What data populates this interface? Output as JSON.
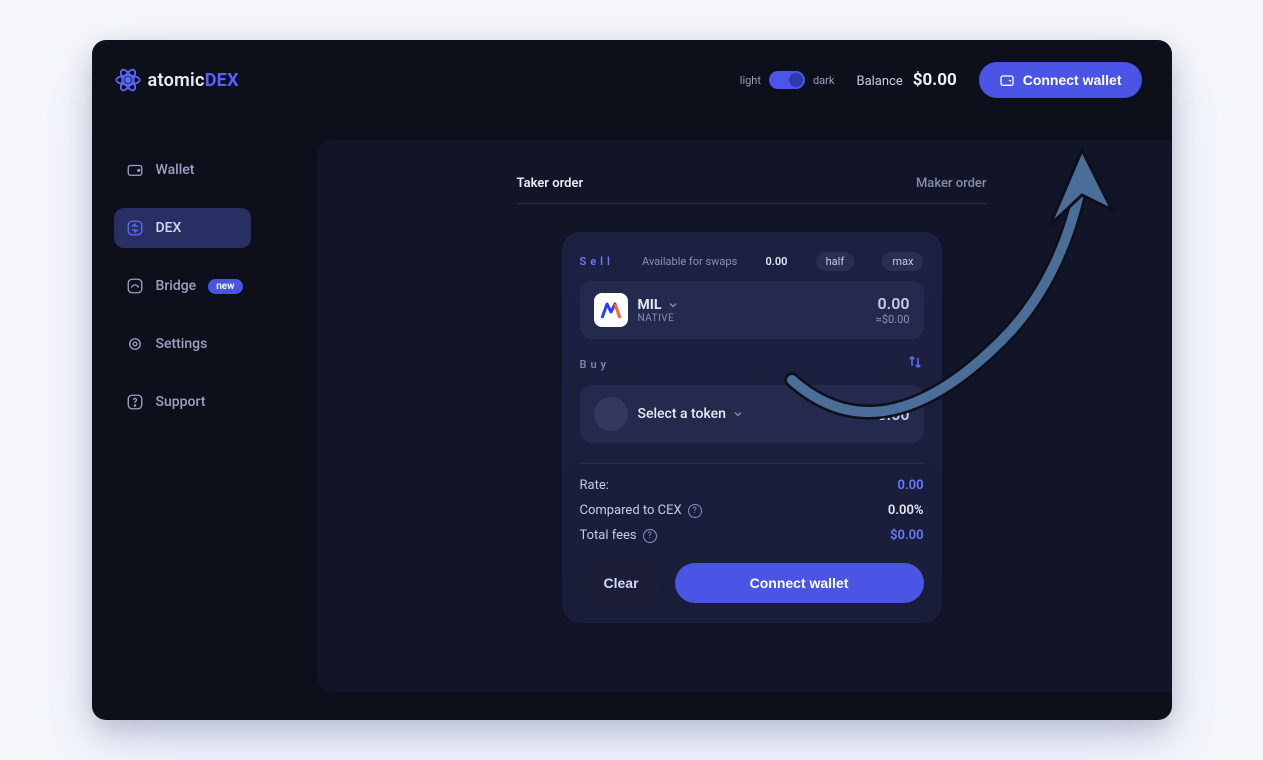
{
  "brand": {
    "part1": "atomic",
    "part2": "DEX"
  },
  "header": {
    "theme_light": "light",
    "theme_dark": "dark",
    "balance_label": "Balance",
    "balance_value": "$0.00",
    "connect_label": "Connect wallet"
  },
  "sidebar": {
    "items": [
      {
        "label": "Wallet"
      },
      {
        "label": "DEX"
      },
      {
        "label": "Bridge",
        "badge": "new"
      },
      {
        "label": "Settings"
      },
      {
        "label": "Support"
      }
    ]
  },
  "tabs": {
    "taker": "Taker order",
    "maker": "Maker order"
  },
  "swap": {
    "sell_label": "Sell",
    "available_label": "Available for swaps",
    "available_value": "0.00",
    "half": "half",
    "max": "max",
    "sell_token_symbol": "MIL",
    "sell_token_sub": "NATIVE",
    "sell_amount": "0.00",
    "sell_amount_fiat": "≈$0.00",
    "buy_label": "Buy",
    "buy_select_label": "Select a token",
    "buy_amount": "0.00",
    "rate_label": "Rate:",
    "rate_value": "0.00",
    "cex_label": "Compared to CEX",
    "cex_value": "0.00%",
    "fees_label": "Total fees",
    "fees_value": "$0.00",
    "clear_label": "Clear",
    "connect_label": "Connect wallet"
  }
}
